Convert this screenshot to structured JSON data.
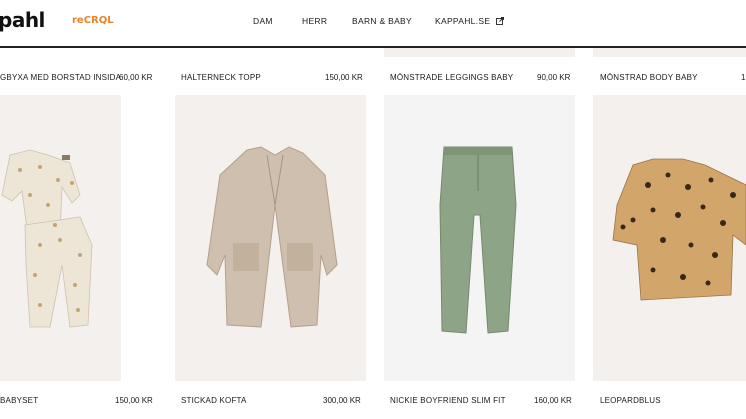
{
  "header": {
    "logo_text": "pahl",
    "logo_sub": "reCRQL",
    "nav": [
      "DAM",
      "HERR",
      "BARN & BABY",
      "KAPPAHL.SE"
    ]
  },
  "products_row1": [
    {
      "name": "GBYXA MED BORSTAD INSIDA",
      "price": "60,00 KR"
    },
    {
      "name": "HALTERNECK TOPP",
      "price": "150,00 KR"
    },
    {
      "name": "MÖNSTRADE LEGGINGS BABY",
      "price": "90,00 KR"
    },
    {
      "name": "MÖNSTRAD BODY BABY",
      "price": "1"
    }
  ],
  "products_row2": [
    {
      "name": "BABYSET",
      "price": "150,00 KR"
    },
    {
      "name": "STICKAD KOFTA",
      "price": "300,00 KR"
    },
    {
      "name": "NICKIE BOYFRIEND SLIM FIT",
      "price": "160,00 KR"
    },
    {
      "name": "LEOPARDBLUS",
      "price": ""
    }
  ],
  "colors": {
    "accent": "#e8822b",
    "card_bg": "#f3f0ed"
  }
}
